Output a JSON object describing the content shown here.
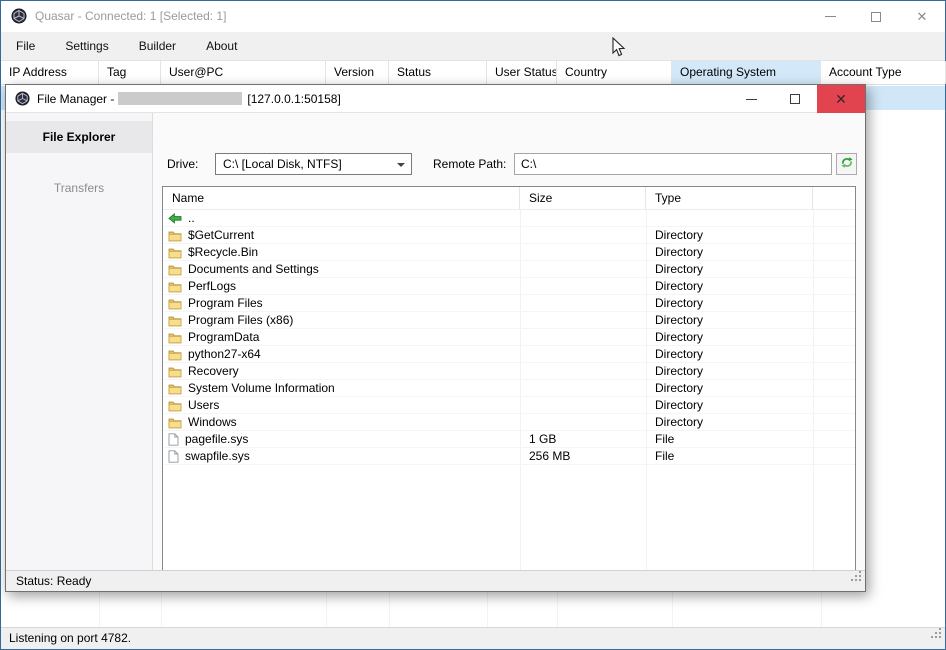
{
  "main_window": {
    "title": "Quasar - Connected: 1 [Selected: 1]",
    "menu": [
      "File",
      "Settings",
      "Builder",
      "About"
    ],
    "columns": [
      "IP Address",
      "Tag",
      "User@PC",
      "Version",
      "Status",
      "User Status",
      "Country",
      "Operating System",
      "Account Type"
    ],
    "highlighted_column": "Operating System",
    "status_bar": "Listening on port 4782."
  },
  "file_manager": {
    "title_prefix": "File Manager -",
    "title_suffix": "[127.0.0.1:50158]",
    "tabs": [
      {
        "label": "File Explorer",
        "selected": true
      },
      {
        "label": "Transfers",
        "selected": false
      }
    ],
    "toolbar": {
      "drive_label": "Drive:",
      "drive_value": "C:\\ [Local Disk, NTFS]",
      "remote_path_label": "Remote Path:",
      "remote_path_value": "C:\\"
    },
    "list": {
      "columns": [
        "Name",
        "Size",
        "Type",
        ""
      ],
      "rows": [
        {
          "icon": "up-arrow",
          "name": "..",
          "size": "",
          "type": ""
        },
        {
          "icon": "folder",
          "name": "$GetCurrent",
          "size": "",
          "type": "Directory"
        },
        {
          "icon": "folder",
          "name": "$Recycle.Bin",
          "size": "",
          "type": "Directory"
        },
        {
          "icon": "folder",
          "name": "Documents and Settings",
          "size": "",
          "type": "Directory"
        },
        {
          "icon": "folder",
          "name": "PerfLogs",
          "size": "",
          "type": "Directory"
        },
        {
          "icon": "folder",
          "name": "Program Files",
          "size": "",
          "type": "Directory"
        },
        {
          "icon": "folder",
          "name": "Program Files (x86)",
          "size": "",
          "type": "Directory"
        },
        {
          "icon": "folder",
          "name": "ProgramData",
          "size": "",
          "type": "Directory"
        },
        {
          "icon": "folder",
          "name": "python27-x64",
          "size": "",
          "type": "Directory"
        },
        {
          "icon": "folder",
          "name": "Recovery",
          "size": "",
          "type": "Directory"
        },
        {
          "icon": "folder",
          "name": "System Volume Information",
          "size": "",
          "type": "Directory"
        },
        {
          "icon": "folder",
          "name": "Users",
          "size": "",
          "type": "Directory"
        },
        {
          "icon": "folder",
          "name": "Windows",
          "size": "",
          "type": "Directory"
        },
        {
          "icon": "file",
          "name": "pagefile.sys",
          "size": "1 GB",
          "type": "File"
        },
        {
          "icon": "file",
          "name": "swapfile.sys",
          "size": "256 MB",
          "type": "File"
        }
      ]
    },
    "status_bar": "Status: Ready"
  },
  "icons": {
    "app": "quasar-logo",
    "minimize": "minimize-icon",
    "maximize": "maximize-icon",
    "close": "close-icon",
    "close_glyph": "✕",
    "refresh": "refresh-icon",
    "folder": "folder-icon",
    "file": "file-icon",
    "up_arrow": "up-directory-arrow-icon"
  },
  "colors": {
    "window_border": "#35699b",
    "close_button_red": "#e2444f",
    "selected_row_blue": "#cfe7f8",
    "column_highlight_blue": "#d3e8f8",
    "folder_yellow": "#f7d87c",
    "arrow_green": "#3fae49",
    "refresh_green": "#2e9e3a"
  }
}
